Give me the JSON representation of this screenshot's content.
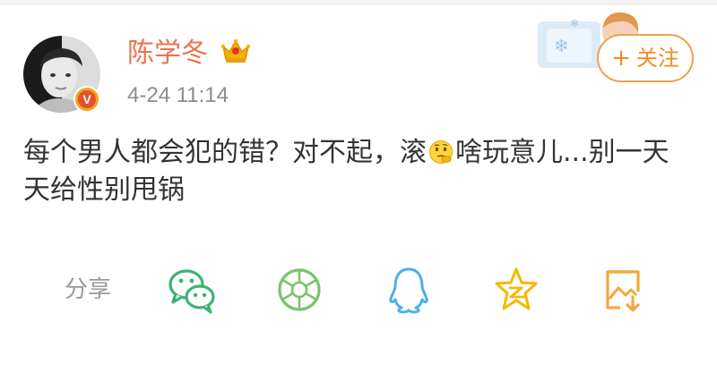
{
  "header": {
    "username": "陈学冬",
    "timestamp": "4-24 11:14",
    "verified_badge_letter": "V",
    "follow_label": "关注",
    "follow_plus": "+"
  },
  "post": {
    "text_before_emoji": "每个男人都会犯的错？对不起，滚",
    "emoji_name": "thinking-face",
    "text_after_emoji": "啥玩意儿...别一天天给性别甩锅"
  },
  "share": {
    "label": "分享",
    "targets": [
      {
        "name": "wechat-icon",
        "color": "#3cb371"
      },
      {
        "name": "moments-icon",
        "color": "#7cc36b"
      },
      {
        "name": "qq-icon",
        "color": "#4ab0e8"
      },
      {
        "name": "qzone-icon",
        "color": "#f5b800"
      },
      {
        "name": "save-image-icon",
        "color": "#f2a93b"
      }
    ]
  },
  "colors": {
    "username": "#eb7350",
    "accent": "#f28c1e",
    "text": "#333333",
    "muted": "#8c8c8c"
  }
}
